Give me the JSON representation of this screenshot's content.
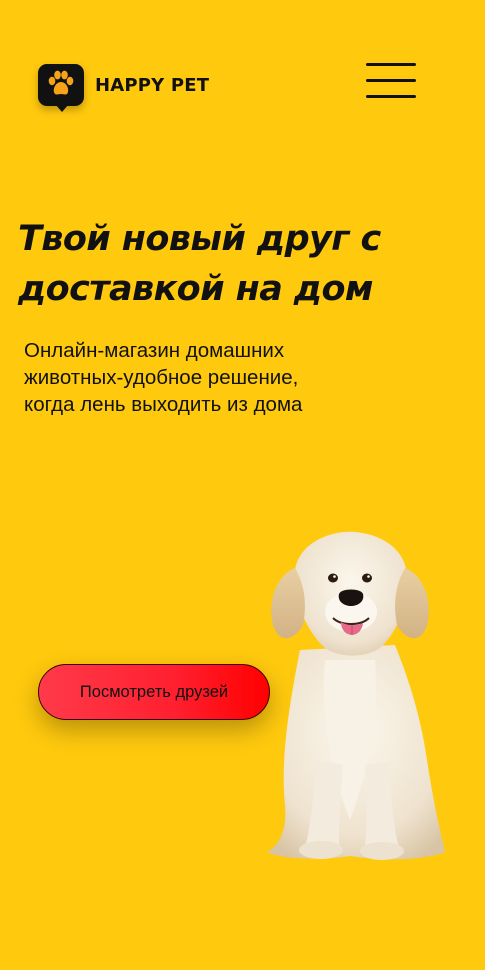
{
  "brand": {
    "name": "HAPPY PET",
    "logo_icon": "paw-icon"
  },
  "header": {
    "menu_icon": "hamburger-menu-icon"
  },
  "hero": {
    "title_line1": "Твой новый друг с",
    "title_line2": "доставкой на дом",
    "subtitle_line1": "Онлайн-магазин домашних",
    "subtitle_line2": "животных-удобное решение,",
    "subtitle_line3": "когда лень выходить из дома",
    "cta_label": "Посмотреть друзей",
    "image": "golden-retriever-dog"
  },
  "colors": {
    "background": "#FFC90E",
    "text": "#111111",
    "cta_gradient_start": "#FF3A4A",
    "cta_gradient_end": "#FF0000",
    "paw": "#F7A318"
  }
}
